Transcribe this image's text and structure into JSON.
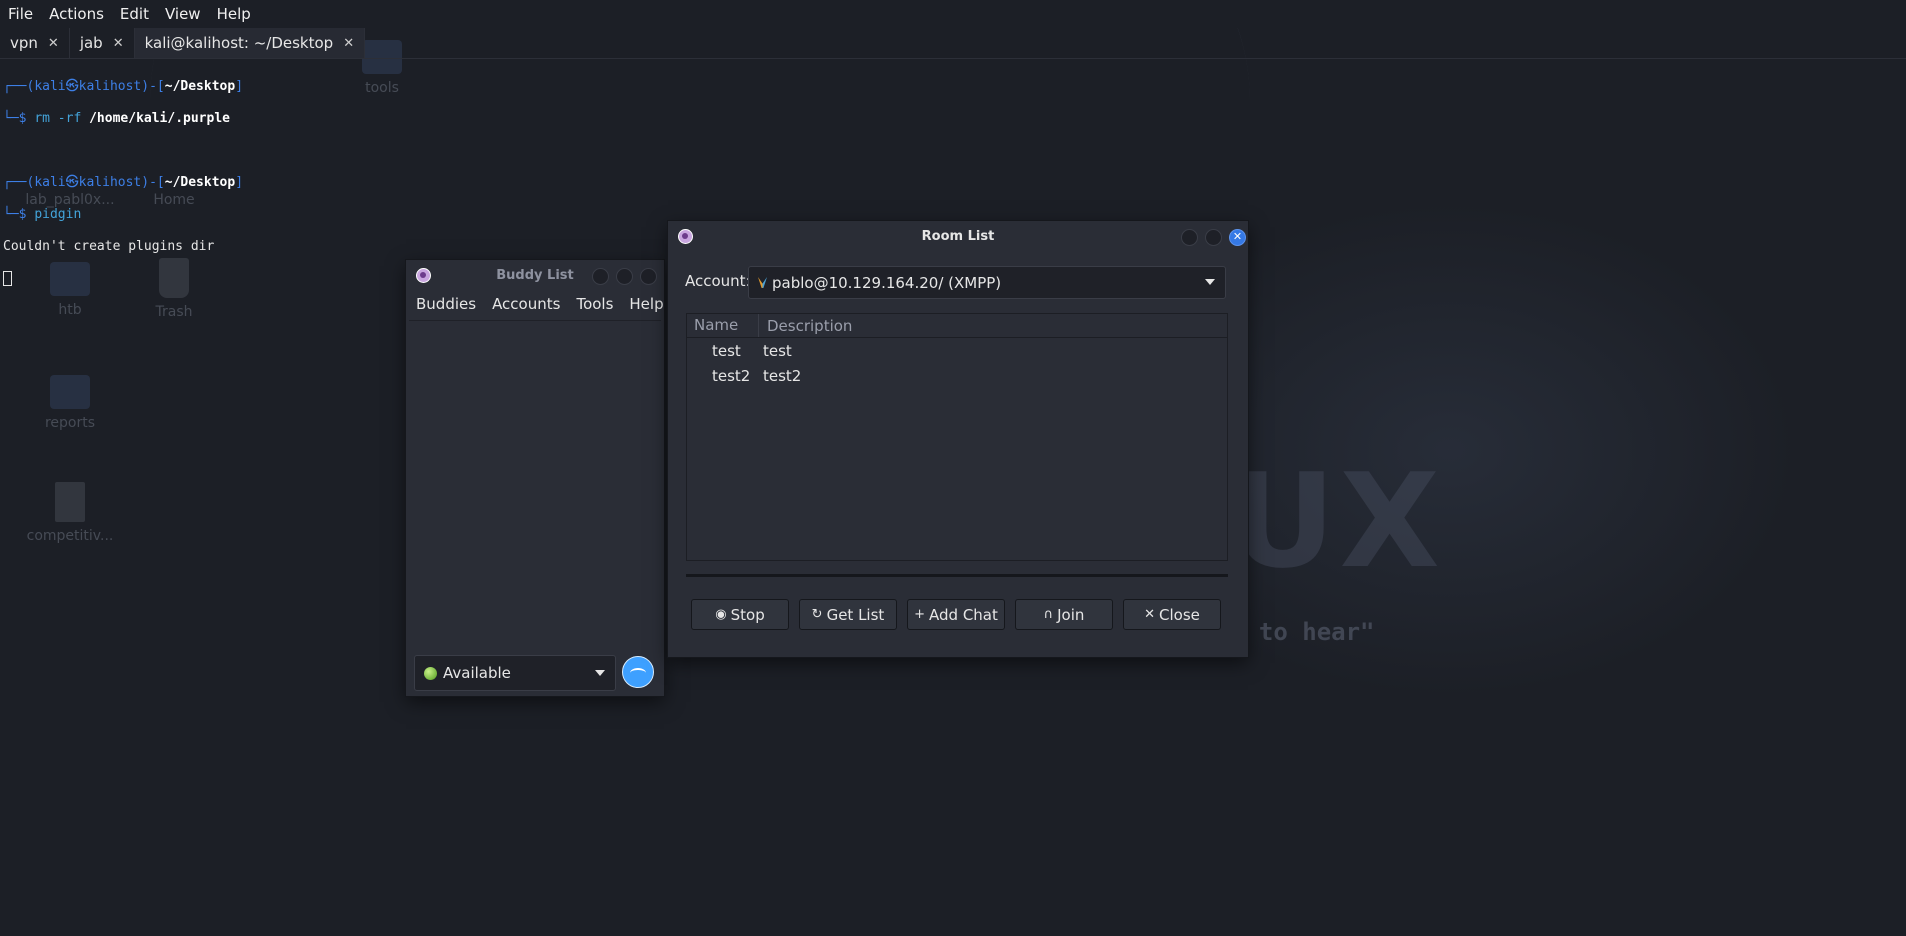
{
  "terminal": {
    "menu": [
      "File",
      "Actions",
      "Edit",
      "View",
      "Help"
    ],
    "tabs": [
      {
        "label": "vpn",
        "close": "✕"
      },
      {
        "label": "jab",
        "close": "✕"
      },
      {
        "label": "kali@kalihost: ~/Desktop",
        "close": "✕"
      }
    ],
    "lines": {
      "prompt_user": "kali",
      "prompt_at": "㉿",
      "prompt_host": "kalihost",
      "prompt_dir": "~/Desktop",
      "cmd1": "rm",
      "cmd1_flag": "-rf",
      "cmd1_arg": "/home/kali/.purple",
      "cmd2": "pidgin",
      "output": "Couldn't create plugins dir"
    }
  },
  "desktop": {
    "icons": [
      "tools",
      "lab_pabl0x...",
      "Home",
      "htb",
      "Trash",
      "reports",
      "competitiv..."
    ],
    "background_word": "UX",
    "background_quote": "- to hear\""
  },
  "buddy_list": {
    "title": "Buddy List",
    "menu": [
      "Buddies",
      "Accounts",
      "Tools",
      "Help"
    ],
    "status": "Available"
  },
  "room_list": {
    "title": "Room List",
    "close_glyph": "✕",
    "account_label": "Account:",
    "account_value": "pablo@10.129.164.20/ (XMPP)",
    "columns": {
      "name": "Name",
      "description": "Description"
    },
    "rooms": [
      {
        "name": "test",
        "description": "test"
      },
      {
        "name": "test2",
        "description": "test2"
      }
    ],
    "buttons": {
      "stop": {
        "icon": "◉",
        "label": "Stop"
      },
      "get_list": {
        "icon": "↻",
        "label": "Get List"
      },
      "add_chat": {
        "icon": "+",
        "label": "Add Chat"
      },
      "join": {
        "icon": "∩",
        "label": "Join"
      },
      "close": {
        "icon": "✕",
        "label": "Close"
      }
    }
  },
  "colors": {
    "accent": "#3579e6",
    "prompt_blue": "#3d7fe6",
    "status_green": "#4e9a1c",
    "background": "#1c1f26"
  }
}
